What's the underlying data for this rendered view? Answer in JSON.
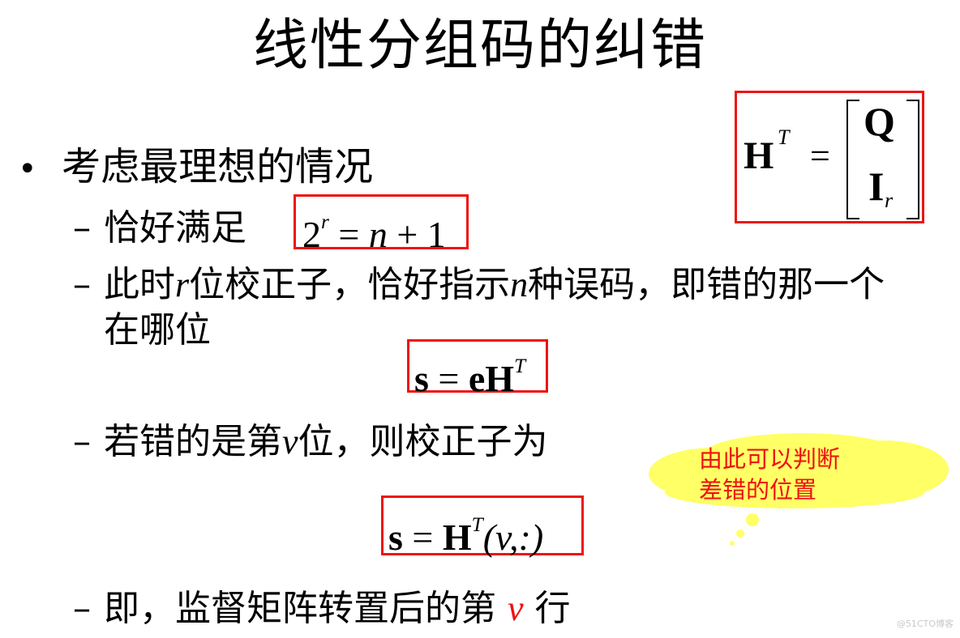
{
  "slide": {
    "title": "线性分组码的纠错",
    "bullet_main": "考虑最理想的情况",
    "sub1": {
      "text": "恰好满足",
      "formula": {
        "base": "2",
        "exp": "r",
        "rest": " = ",
        "n": "n",
        "tail": " + 1"
      }
    },
    "sub2": {
      "part1": "此时",
      "r": "r",
      "part2": "位校正子，恰好指示",
      "n": "n",
      "part3": "种误码，即错的那一个",
      "line2": "在哪位"
    },
    "formula_syndrome": {
      "s": "s",
      "eq": " = ",
      "eH": "eH",
      "T": "T"
    },
    "sub3": {
      "part1": "若错的是第",
      "v": "v",
      "part2": "位，则校正子为"
    },
    "formula_row": {
      "s": "s",
      "eq": " = ",
      "H": "H",
      "T": "T",
      "arg": "(v,:)"
    },
    "sub4": {
      "part1": "即，监督矩阵转置后的第",
      "v": "v",
      "part2": "行"
    },
    "matrix": {
      "H": "H",
      "T": "T",
      "eq": "=",
      "Q": "Q",
      "I": "I",
      "r": "r"
    },
    "callout": {
      "line1": "由此可以判断",
      "line2": "差错的位置"
    },
    "watermark": "@51CTO博客"
  },
  "colors": {
    "accent_red": "#ee1111",
    "cloud_yellow": "#ffff66",
    "text": "#000000"
  }
}
